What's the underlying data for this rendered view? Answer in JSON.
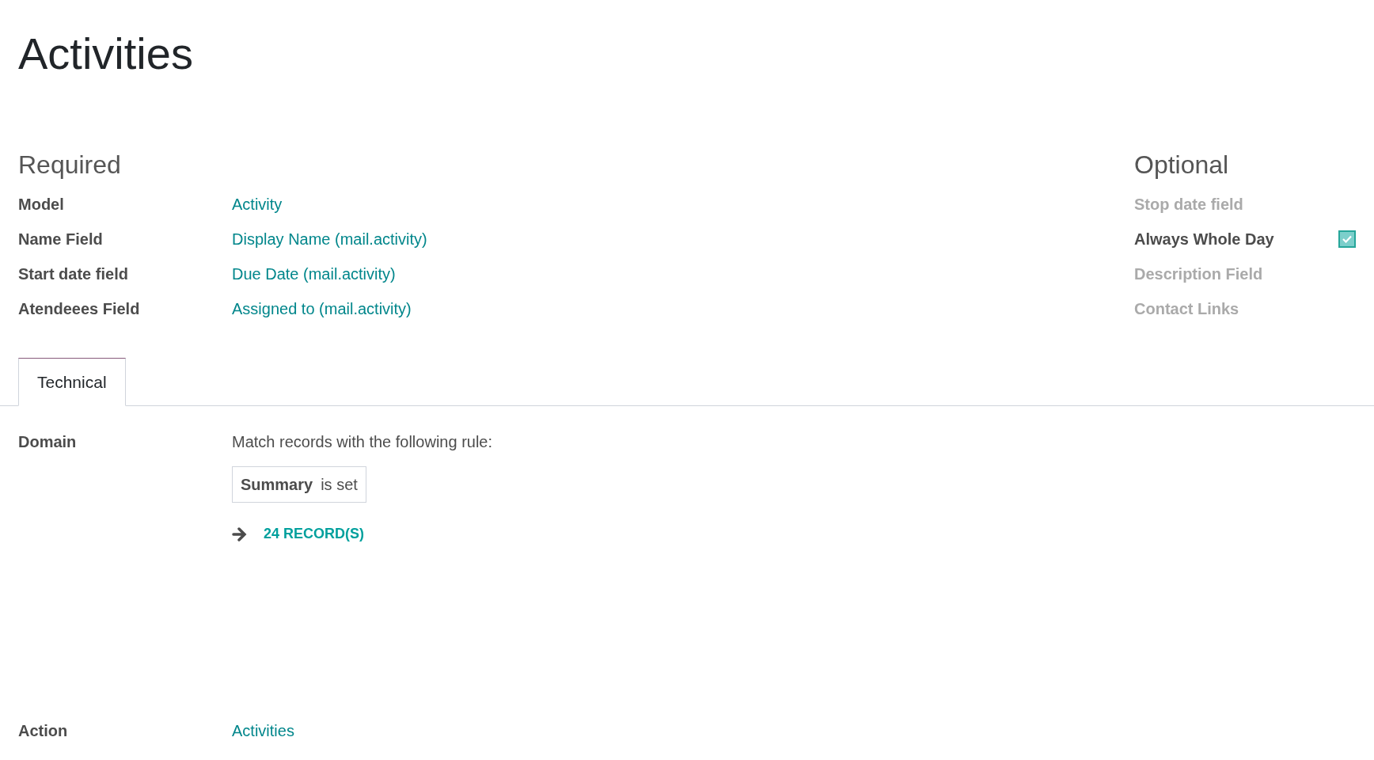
{
  "title": "Activities",
  "required": {
    "heading": "Required",
    "fields": [
      {
        "label": "Model",
        "value": "Activity"
      },
      {
        "label": "Name Field",
        "value": "Display Name (mail.activity)"
      },
      {
        "label": "Start date field",
        "value": "Due Date (mail.activity)"
      },
      {
        "label": "Atendeees Field",
        "value": "Assigned to (mail.activity)"
      }
    ]
  },
  "optional": {
    "heading": "Optional",
    "fields": [
      {
        "label": "Stop date field",
        "disabled": true,
        "kind": "empty"
      },
      {
        "label": "Always Whole Day",
        "disabled": false,
        "kind": "checkbox",
        "checked": true
      },
      {
        "label": "Description Field",
        "disabled": true,
        "kind": "empty"
      },
      {
        "label": "Contact Links",
        "disabled": true,
        "kind": "empty"
      }
    ]
  },
  "tabs": [
    {
      "label": "Technical",
      "selected": true
    }
  ],
  "domain": {
    "label": "Domain",
    "intro": "Match records with the following rule:",
    "rule": {
      "field": "Summary",
      "operator": "is set"
    },
    "records": "24 RECORD(S)"
  },
  "action": {
    "label": "Action",
    "value": "Activities"
  }
}
